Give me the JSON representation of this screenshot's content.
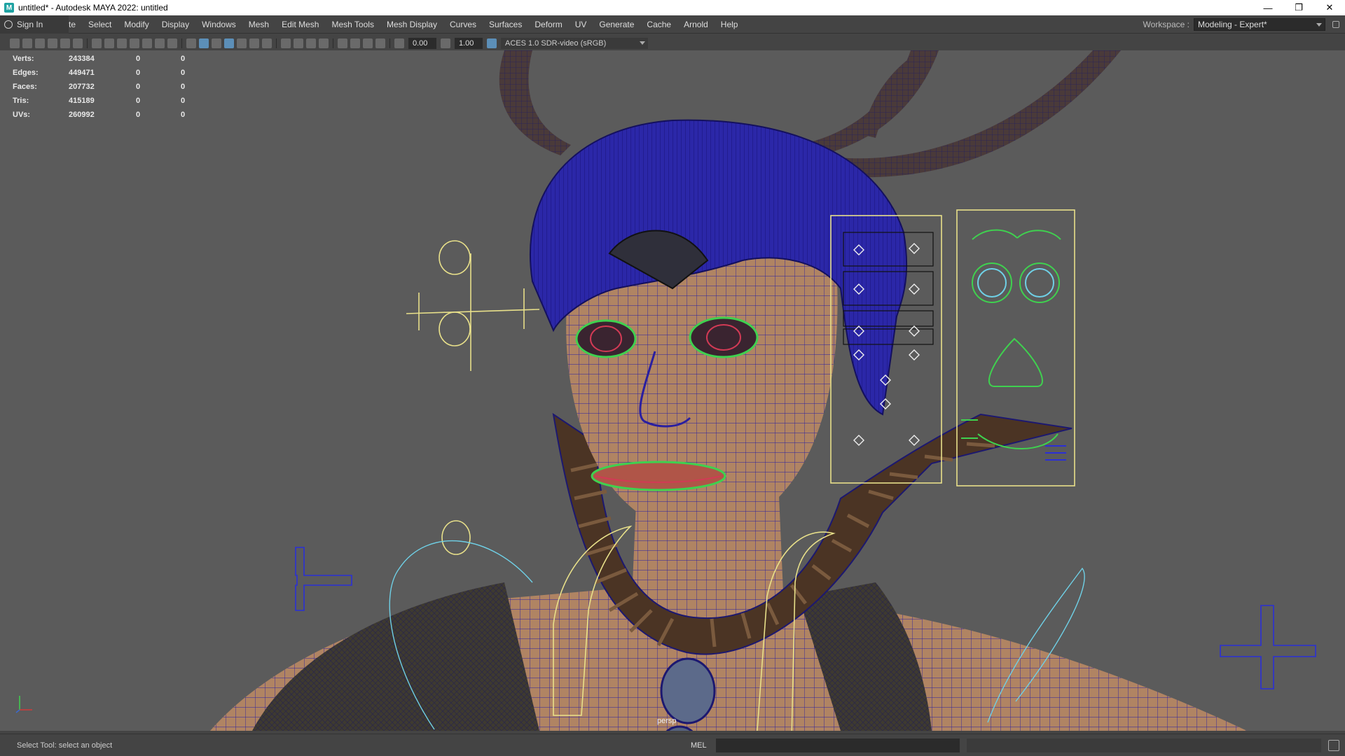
{
  "window": {
    "icon": "M",
    "title": "untitled* - Autodesk MAYA 2022: untitled",
    "minimize": "—",
    "restore": "❐",
    "close": "✕"
  },
  "menubar": {
    "sign_in": "Sign In",
    "partial_item": "te",
    "items": [
      "Select",
      "Modify",
      "Display",
      "Windows",
      "Mesh",
      "Edit Mesh",
      "Mesh Tools",
      "Mesh Display",
      "Curves",
      "Surfaces",
      "Deform",
      "UV",
      "Generate",
      "Cache",
      "Arnold",
      "Help"
    ],
    "workspace_label": "Workspace :",
    "workspace_value": "Modeling - Expert*"
  },
  "toolbar": {
    "exposure": "0.00",
    "gamma": "1.00",
    "color_space": "ACES 1.0 SDR-video (sRGB)"
  },
  "hud": {
    "rows": [
      {
        "label": "Verts:",
        "v1": "243384",
        "v2": "0",
        "v3": "0"
      },
      {
        "label": "Edges:",
        "v1": "449471",
        "v2": "0",
        "v3": "0"
      },
      {
        "label": "Faces:",
        "v1": "207732",
        "v2": "0",
        "v3": "0"
      },
      {
        "label": "Tris:",
        "v1": "415189",
        "v2": "0",
        "v3": "0"
      },
      {
        "label": "UVs:",
        "v1": "260992",
        "v2": "0",
        "v3": "0"
      }
    ]
  },
  "viewport": {
    "camera": "persp",
    "colors": {
      "background": "#5b5b5b",
      "wire": "#2a1fa0",
      "skin": "#b08463",
      "control_yellow": "#e8e08a",
      "control_green": "#3fd14f",
      "control_cyan": "#6fd0e6",
      "control_blue": "#2b2fd6"
    }
  },
  "statusbar": {
    "message": "Select Tool: select an object",
    "mel": "MEL"
  }
}
